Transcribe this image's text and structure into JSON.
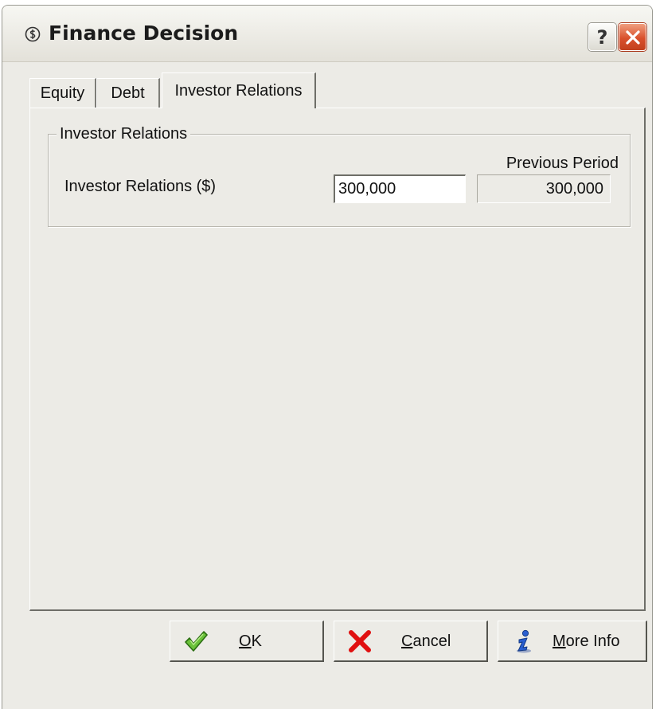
{
  "window": {
    "title": "Finance Decision",
    "icon": "finance-icon",
    "help_label": "?",
    "close_icon": "close-icon"
  },
  "tabs": [
    {
      "label": "Equity",
      "active": false
    },
    {
      "label": "Debt",
      "active": false
    },
    {
      "label": "Investor Relations",
      "active": true
    }
  ],
  "group": {
    "legend": "Investor Relations",
    "previous_period_label": "Previous Period",
    "field_label": "Investor Relations ($)",
    "field_value": "300,000",
    "previous_value": "300,000"
  },
  "buttons": {
    "ok": {
      "accel": "O",
      "rest": "K",
      "icon": "checkmark-icon"
    },
    "cancel": {
      "accel": "C",
      "rest": "ancel",
      "icon": "x-icon"
    },
    "more_info": {
      "accel": "M",
      "rest": "ore Info",
      "icon": "info-icon"
    }
  },
  "colors": {
    "dialog_bg": "#ecebe6",
    "close_red": "#d9502c",
    "ok_green": "#3a9a1c",
    "cancel_red": "#e01010",
    "info_blue": "#1f4fb8"
  }
}
